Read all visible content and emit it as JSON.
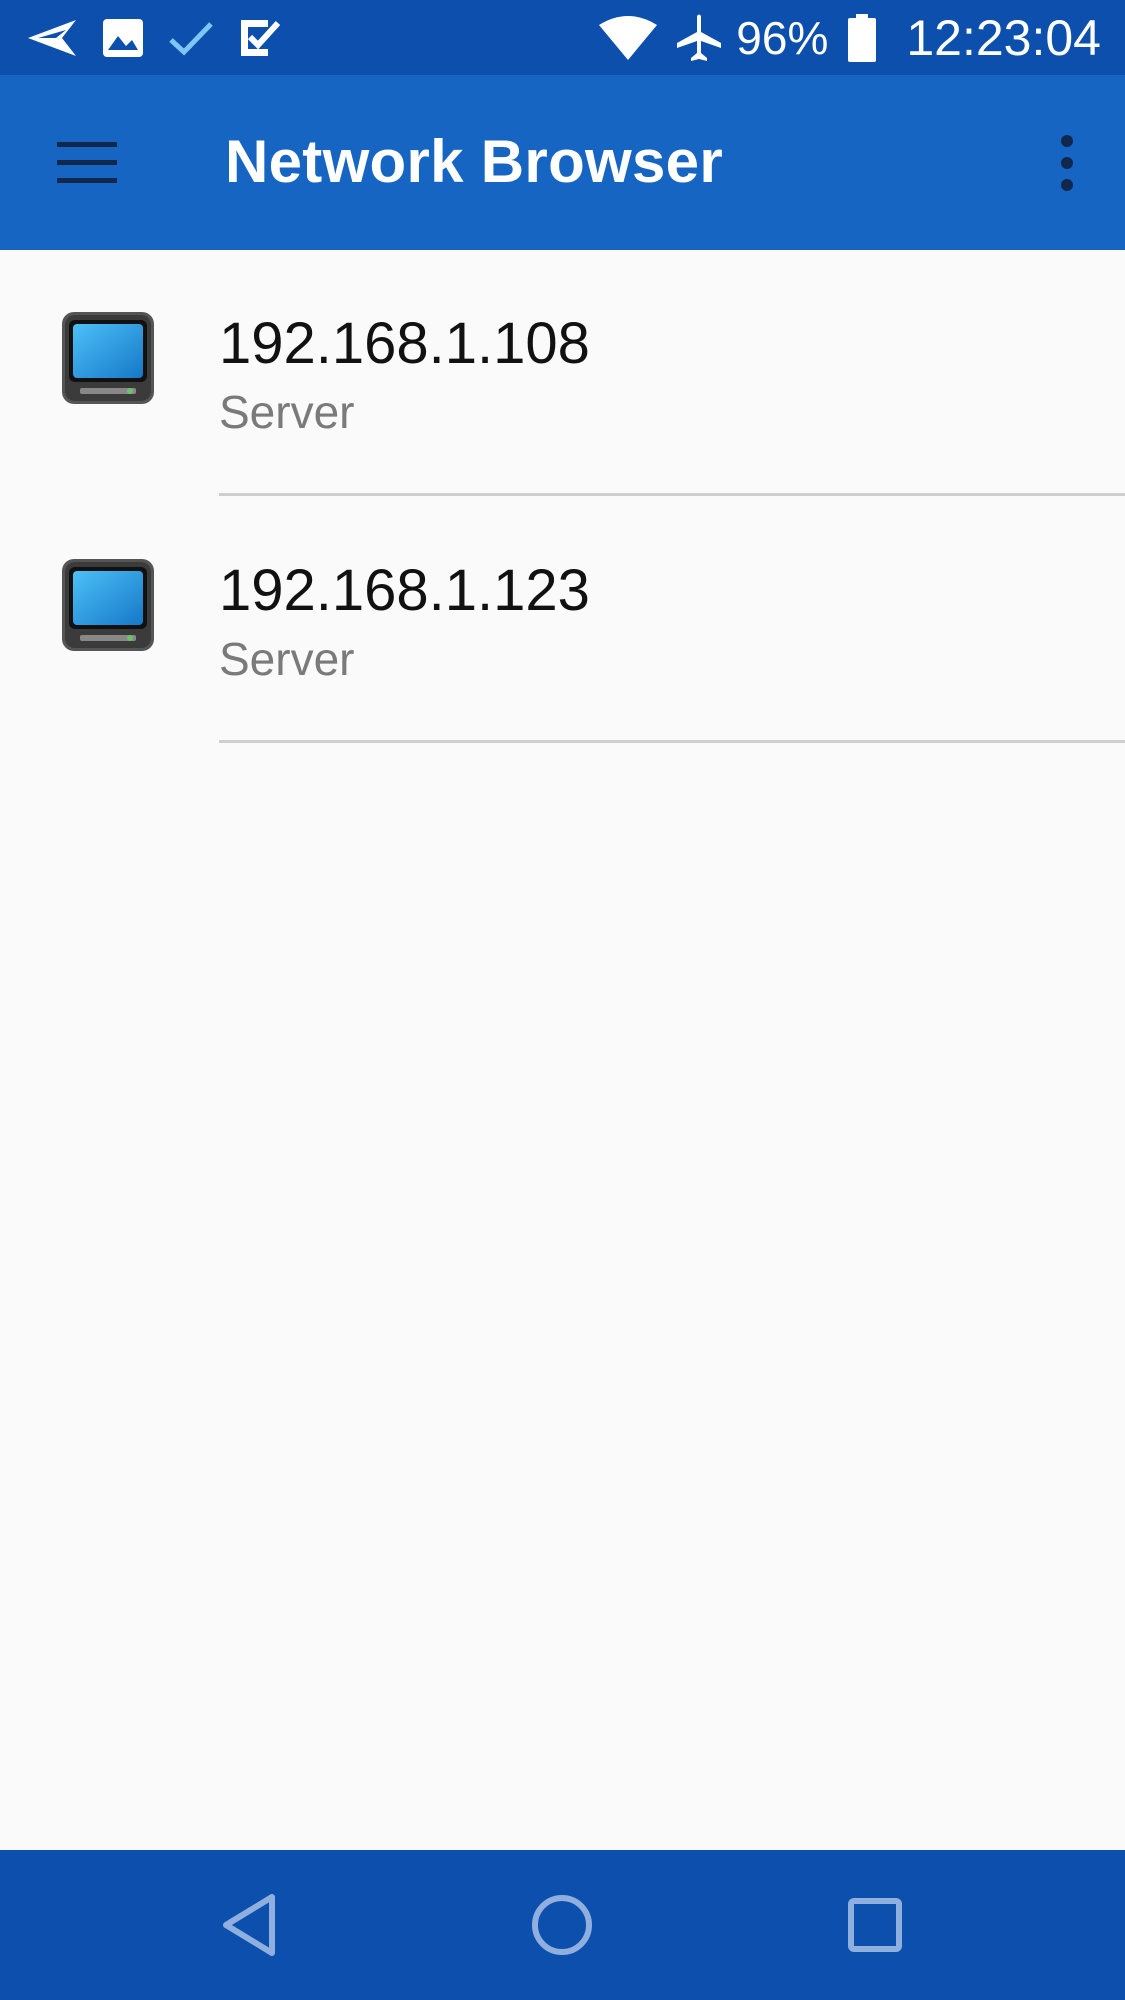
{
  "status_bar": {
    "left_icons": [
      "send-icon",
      "image-icon",
      "check-icon",
      "task-icon"
    ],
    "right_icons": [
      "wifi-icon",
      "airplane-icon",
      "battery-icon"
    ],
    "battery_percent": "96%",
    "time": "12:23:04"
  },
  "app_bar": {
    "title": "Network Browser",
    "menu_icon": "hamburger-menu-icon",
    "overflow_icon": "more-vert-icon"
  },
  "devices": [
    {
      "address": "192.168.1.108",
      "type": "Server",
      "icon": "computer-monitor-icon"
    },
    {
      "address": "192.168.1.123",
      "type": "Server",
      "icon": "computer-monitor-icon"
    }
  ],
  "nav_bar": {
    "buttons": [
      "back-triangle-icon",
      "home-circle-icon",
      "recents-square-icon"
    ]
  },
  "colors": {
    "status_bar": "#0d4fad",
    "app_bar": "#1765c3",
    "nav_bar": "#0d4fad",
    "background": "#fafafa",
    "monitor_screen": "#1e9be8"
  }
}
